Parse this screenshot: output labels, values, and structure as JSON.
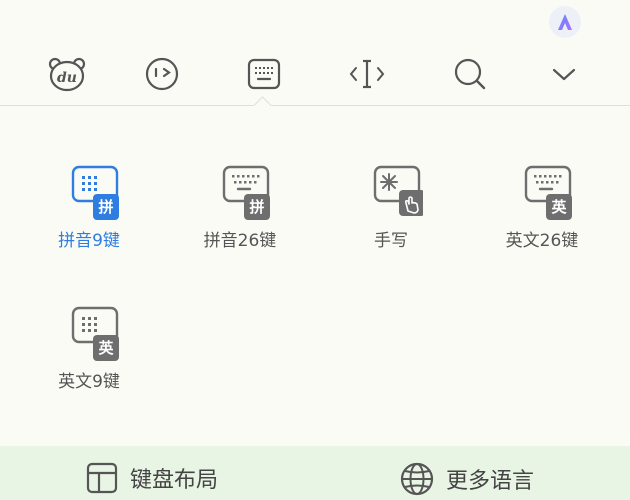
{
  "toolbar": {
    "items": [
      {
        "name": "baidu-logo-icon"
      },
      {
        "name": "emoji-icon"
      },
      {
        "name": "keyboard-icon"
      },
      {
        "name": "cursor-icon"
      },
      {
        "name": "search-icon"
      },
      {
        "name": "chevron-down-icon"
      }
    ]
  },
  "layouts": [
    {
      "label": "拼音9键",
      "badge": "拼",
      "selected": true
    },
    {
      "label": "拼音26键",
      "badge": "拼",
      "selected": false
    },
    {
      "label": "手写",
      "badge": "",
      "selected": false
    },
    {
      "label": "英文26键",
      "badge": "英",
      "selected": false
    },
    {
      "label": "英文9键",
      "badge": "英",
      "selected": false
    }
  ],
  "bottom": {
    "keyboard_layout_label": "键盘布局",
    "more_languages_label": "更多语言"
  },
  "colors": {
    "accent": "#2f7de1",
    "background": "#fbfbf5",
    "bottom_bar": "#e9f5e4",
    "icon_gray": "#6e6e6e"
  }
}
